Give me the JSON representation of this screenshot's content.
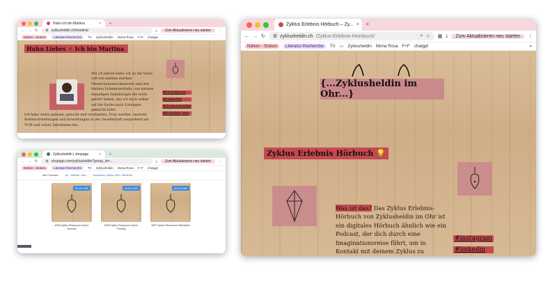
{
  "window1": {
    "tab_title": "Huhu ich bin Martina",
    "url": "zyklusheldin.ch/martina/",
    "update_label": "Zum Aktualisieren neu starten",
    "bookmarks": [
      "Nähen - Stoken",
      "Literatur-Recherche",
      "TV",
      "Zyklusheldin",
      "Mona Rosa",
      "F+F",
      "chatgpt"
    ],
    "heading": "Huhu Liebes ☼ Ich bin Martina.",
    "para1": "Mit 24 Jahren hatte ich an die Vulva voll von meinen starken Menstruationsschmerzen und den bleiben Schmerzmitteln, von meinen damaligen Gynäkologin die nicht gehört haben, das ich mich selber auf die Suche nach Lösungen gemacht habe.",
    "para2": "Ich habe vieles gelesen, gesucht und verstanden, Frau werden, unseren Rollenvorstellungen und Erwartungen in der Gesellschaft ausprobiert als TCM und schon Tabuthema die...",
    "links": [
      "#instagram",
      "#linkedin",
      "#Zyklusheldin",
      "#Erzähle mir"
    ]
  },
  "window2": {
    "tab_title": "Zyklusheldin | shopage",
    "url": "shopage.com/zyklusheldin?group_id=...",
    "update_label": "Zum Aktualisieren neu starten",
    "bookmarks": [
      "Nähen - Stoken",
      "Literatur-Recherche",
      "TV",
      "Zyklusheldin",
      "Mona Rosa",
      "F+F",
      "chatgpt"
    ],
    "filters": [
      "Alle Produkte",
      "A4 - Malheft / Abo",
      "Ilustriertes Zyklus-Heft / Werkheft"
    ],
    "products": [
      {
        "price": "22,00 CHF",
        "name": "#006 Zyklus Ressource Innere Sommer"
      },
      {
        "price": "22,00 CHF",
        "name": "#008 Zyklus Ressource Innere Frühling"
      },
      {
        "price": "22,00 CHF",
        "name": "#007 Zyklus Ressource Selbstwert"
      }
    ]
  },
  "window3": {
    "tab_title": "Zyklus Erlebnis Hörbuch – Zy...",
    "url_host": "zyklusheldin.ch",
    "url_path": "/Zyklus-Erlebnis-Hoerbuch/",
    "update_label": "Zum Aktualisieren neu starten",
    "bookmarks": [
      "Nähen - Stoken",
      "Literatur-Recherche",
      "TV",
      "Zyklusheldin",
      "Mona Rosa",
      "F+F",
      "chatgpt"
    ],
    "hero_title": "{...Zyklusheldin im Ohr...}",
    "section_title": "Zyklus Erlebnis Hörbuch 💡",
    "lead_highlight": "Was ist das?",
    "lead_text": " Das Zyklus Erlebnis-Hörbuch von Zyklusheldin im Ohr ist ein digitales Hörbuch ähnlich wie ein Podcast, der dich durch eine Imaginationsreise führt, um in Kontakt mit deinem Zyklus zu kommen. Du hörst dabei nicht nur zu, sondern malst mit einfachen Skizzen und Kritzeleien, deine",
    "links": [
      "#instagram",
      "#linkedin"
    ]
  },
  "colors": {
    "accent_red": "#c44a4f",
    "pink_patch": "#c98a8c",
    "chrome_pink": "#f6d7dd"
  }
}
